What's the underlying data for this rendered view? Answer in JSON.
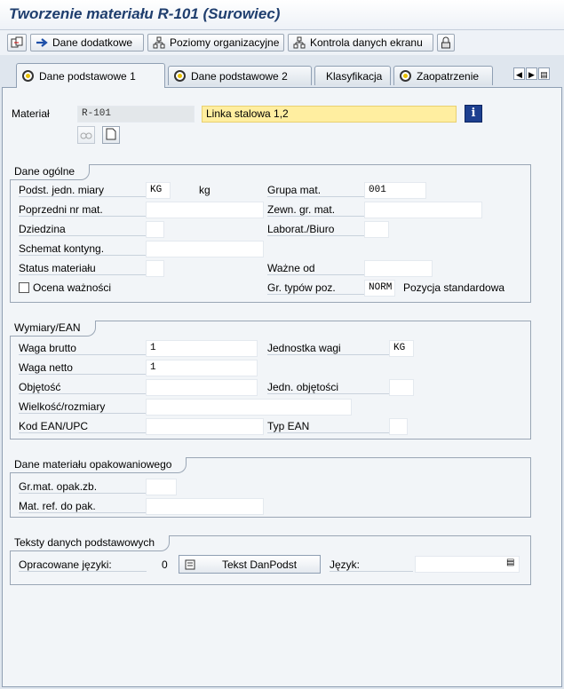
{
  "window": {
    "title": "Tworzenie materiału R-101 (Surowiec)"
  },
  "toolbar": {
    "dane_dodatkowe": "Dane dodatkowe",
    "poziomy": "Poziomy organizacyjne",
    "kontrola": "Kontrola danych ekranu"
  },
  "tabs": [
    {
      "label": "Dane podstawowe 1",
      "active": true
    },
    {
      "label": "Dane podstawowe 2"
    },
    {
      "label": "Klasyfikacja"
    },
    {
      "label": "Zaopatrzenie"
    }
  ],
  "header": {
    "material_label": "Materiał",
    "material_value": "R-101",
    "description_value": "Linka stalowa 1,2"
  },
  "general": {
    "title": "Dane ogólne",
    "base_uom_label": "Podst. jedn. miary",
    "base_uom_value": "KG",
    "base_uom_text": "kg",
    "prev_nr_label": "Poprzedni nr mat.",
    "prev_nr_value": "",
    "division_label": "Dziedzina",
    "division_value": "",
    "schema_label": "Schemat kontyng.",
    "schema_value": "",
    "status_label": "Status materiału",
    "status_value": "",
    "eval_label": "Ocena ważności",
    "mat_group_label": "Grupa mat.",
    "mat_group_value": "001",
    "ext_group_label": "Zewn. gr. mat.",
    "ext_group_value": "",
    "lab_label": "Laborat./Biuro",
    "lab_value": "",
    "valid_from_label": "Ważne od",
    "valid_from_value": "",
    "item_cat_label": "Gr. typów poz.",
    "item_cat_value": "NORM",
    "item_cat_text": "Pozycja standardowa"
  },
  "dimensions": {
    "title": "Wymiary/EAN",
    "gross_label": "Waga brutto",
    "gross_value": "1",
    "net_label": "Waga netto",
    "net_value": "1",
    "volume_label": "Objętość",
    "volume_value": "",
    "size_label": "Wielkość/rozmiary",
    "size_value": "",
    "ean_label": "Kod EAN/UPC",
    "ean_value": "",
    "weight_unit_label": "Jednostka wagi",
    "weight_unit_value": "KG",
    "vol_unit_label": "Jedn. objętości",
    "vol_unit_value": "",
    "ean_type_label": "Typ EAN",
    "ean_type_value": ""
  },
  "packaging": {
    "title": "Dane materiału opakowaniowego",
    "group_label": "Gr.mat. opak.zb.",
    "group_value": "",
    "ref_label": "Mat. ref. do pak.",
    "ref_value": ""
  },
  "texts": {
    "title": "Teksty danych podstawowych",
    "langs_label": "Opracowane języki:",
    "langs_count": "0",
    "button_label": "Tekst DanPodst",
    "language_label": "Język:",
    "language_value": ""
  }
}
